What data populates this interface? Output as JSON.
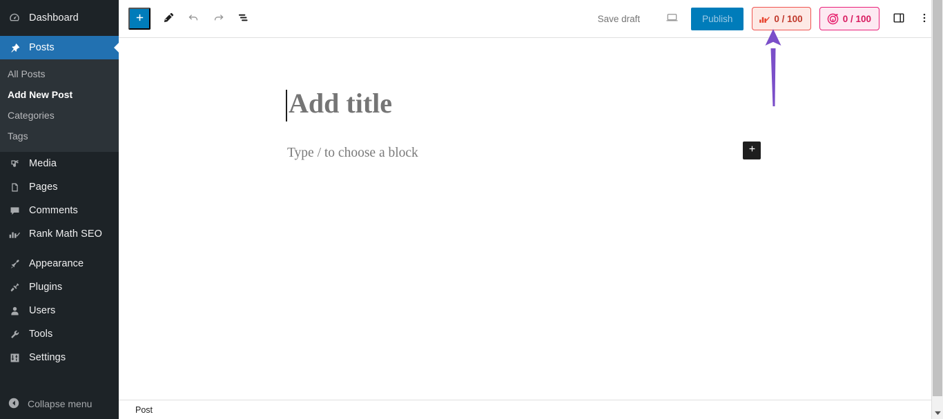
{
  "sidebar": {
    "items": [
      {
        "label": "Dashboard",
        "icon": "dashboard-icon",
        "state": "normal"
      },
      {
        "label": "Posts",
        "icon": "pin-icon",
        "state": "current"
      },
      {
        "label": "Media",
        "icon": "media-icon",
        "state": "normal"
      },
      {
        "label": "Pages",
        "icon": "pages-icon",
        "state": "normal"
      },
      {
        "label": "Comments",
        "icon": "comments-icon",
        "state": "normal"
      },
      {
        "label": "Rank Math SEO",
        "icon": "rank-math-icon",
        "state": "normal"
      },
      {
        "label": "Appearance",
        "icon": "appearance-brush-icon",
        "state": "normal"
      },
      {
        "label": "Plugins",
        "icon": "plugins-plug-icon",
        "state": "normal"
      },
      {
        "label": "Users",
        "icon": "users-icon",
        "state": "normal"
      },
      {
        "label": "Tools",
        "icon": "tools-wrench-icon",
        "state": "normal"
      },
      {
        "label": "Settings",
        "icon": "settings-sliders-icon",
        "state": "normal"
      }
    ],
    "submenu": [
      {
        "label": "All Posts",
        "state": "normal"
      },
      {
        "label": "Add New Post",
        "state": "current"
      },
      {
        "label": "Categories",
        "state": "normal"
      },
      {
        "label": "Tags",
        "state": "normal"
      }
    ],
    "collapse": {
      "label": "Collapse menu",
      "icon": "collapse-arrow-icon"
    },
    "colors": {
      "background": "#1d2327",
      "submenu_background": "#2c3338",
      "current_background": "#2271b1",
      "text": "#c3c4c7"
    }
  },
  "toolbar": {
    "add_block_label": "+",
    "add_block_name": "Toggle block inserter",
    "tools_label": "Tools",
    "undo_label": "Undo",
    "redo_label": "Redo",
    "list_view_label": "List View",
    "save_draft_label": "Save draft",
    "preview_label": "Preview",
    "publish_label": "Publish",
    "settings_label": "Settings",
    "options_label": "Options"
  },
  "scores": {
    "seo": {
      "value": "0 / 100",
      "icon": "rank-math-logo-icon",
      "border_color": "#ef5350",
      "background": "#fde9e5",
      "text_color": "#c0392b"
    },
    "content_ai": {
      "value": "0 / 100",
      "icon": "content-ai-target-icon",
      "border_color": "#e91e78",
      "background": "#fde9f2",
      "text_color": "#d81b60"
    }
  },
  "editor": {
    "title_placeholder": "Add title",
    "body_placeholder": "Type / to choose a block",
    "appender_label": "+"
  },
  "footer": {
    "breadcrumb": "Post"
  },
  "annotation": {
    "arrow_color": "#7b4fc9",
    "points_to": "seo-score-badge"
  }
}
